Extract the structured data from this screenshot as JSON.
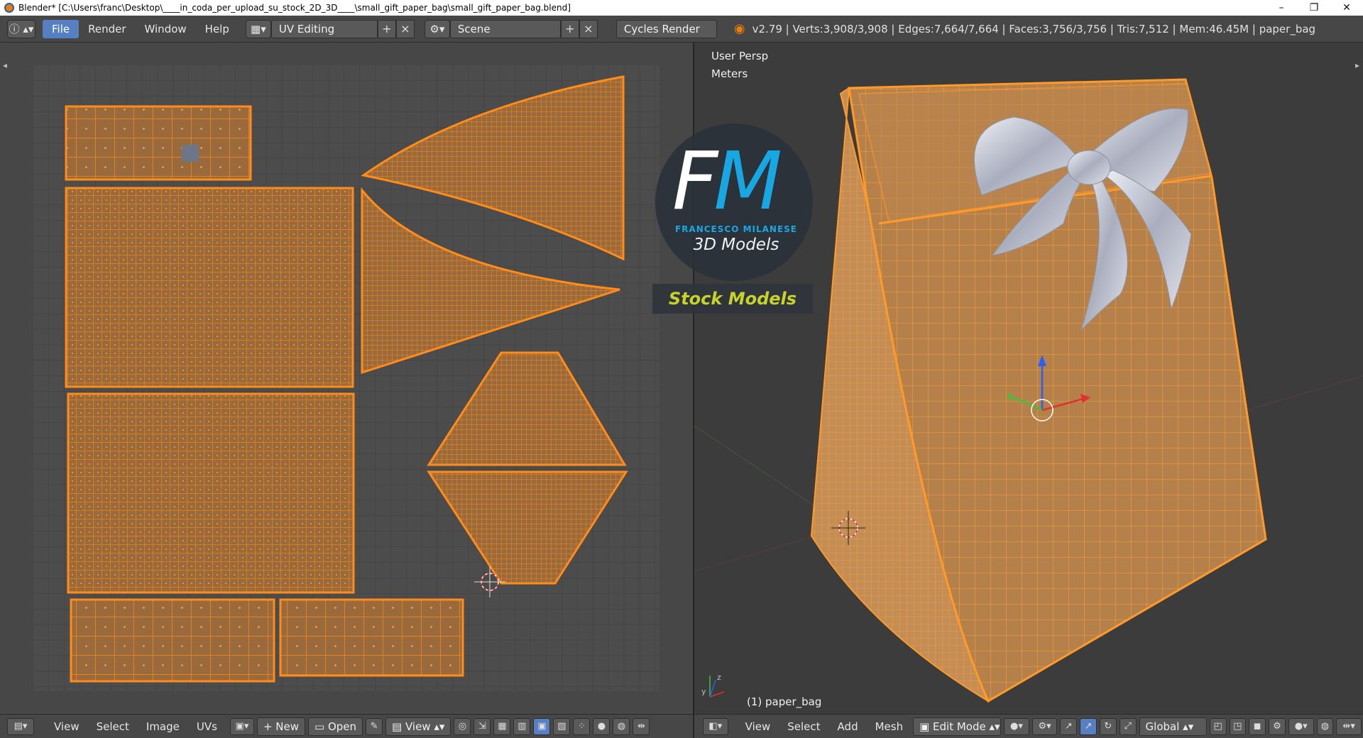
{
  "window": {
    "title": "Blender* [C:\\Users\\franc\\Desktop\\____in_coda_per_upload_su_stock_2D_3D____\\small_gift_paper_bag\\small_gift_paper_bag.blend]",
    "minimize": "–",
    "maximize": "❐",
    "close": "✕"
  },
  "topbar": {
    "menus": [
      "File",
      "Render",
      "Window",
      "Help"
    ],
    "layout": "UV Editing",
    "scene": "Scene",
    "engine": "Cycles Render",
    "stats": "v2.79 | Verts:3,908/3,908 | Edges:7,664/7,664 | Faces:3,756/3,756 | Tris:7,512 | Mem:46.45M | paper_bag"
  },
  "viewport": {
    "view_name": "User Persp",
    "units": "Meters",
    "object_label": "(1) paper_bag"
  },
  "watermark": {
    "initials_f": "F",
    "initials_m": "M",
    "name": "FRANCESCO MILANESE",
    "subtitle": "3D Models",
    "badge": "Stock Models"
  },
  "uv_header": {
    "menus": [
      "View",
      "Select",
      "Image",
      "UVs"
    ],
    "new_label": "New",
    "open_label": "Open",
    "view_label": "View"
  },
  "vp_header": {
    "menus": [
      "View",
      "Select",
      "Add",
      "Mesh"
    ],
    "mode": "Edit Mode",
    "orientation": "Global"
  },
  "colors": {
    "mesh_fill": "#9a6a3c",
    "wire": "#f28a1a",
    "grid_bg": "#474747",
    "accent": "#5680c2"
  }
}
